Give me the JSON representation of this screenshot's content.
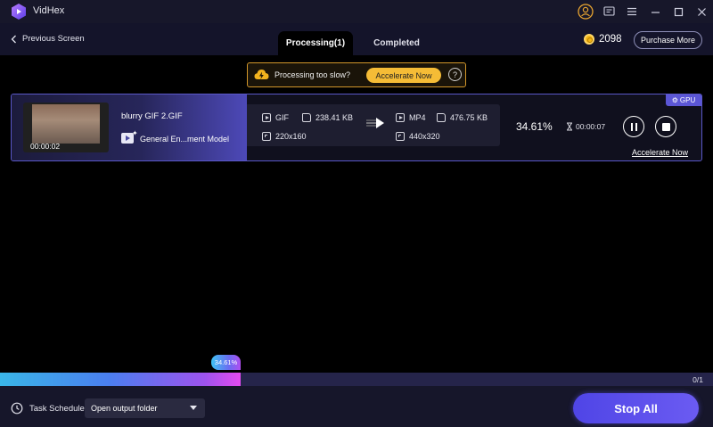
{
  "app": {
    "title": "VidHex"
  },
  "icons": {
    "logo": "vidhex-logo-icon",
    "account": "user-icon",
    "feedback": "feedback-icon",
    "menu": "menu-icon",
    "minimize": "minimize-icon",
    "maximize": "maximize-icon",
    "close": "close-icon"
  },
  "nav": {
    "back_label": "Previous Screen",
    "tabs": [
      {
        "label": "Processing(1)",
        "active": true
      },
      {
        "label": "Completed",
        "active": false
      }
    ],
    "coins": "2098",
    "purchase_label": "Purchase More"
  },
  "banner": {
    "text": "Processing too slow?",
    "button_label": "Accelerate Now",
    "help": "?"
  },
  "task": {
    "duration": "00:00:02",
    "file_name": "blurry GIF 2.GIF",
    "model": "General En...ment Model",
    "source": {
      "format": "GIF",
      "size": "238.41 KB",
      "resolution": "220x160"
    },
    "output": {
      "format": "MP4",
      "size": "476.75 KB",
      "resolution": "440x320"
    },
    "progress": "34.61%",
    "progress_fraction": 0.3461,
    "remaining_time": "00:00:07",
    "gpu_badge": "GPU",
    "accelerate_link": "Accelerate Now"
  },
  "overall": {
    "progress_label": "34.61%",
    "count": "0/1"
  },
  "bottom": {
    "schedule_label": "Task Schedule",
    "schedule_option": "Open output folder",
    "stop_all_label": "Stop All"
  },
  "colors": {
    "accent": "#5b56d6",
    "banner_border": "#d2962a",
    "banner_button": "#f5bc36"
  }
}
